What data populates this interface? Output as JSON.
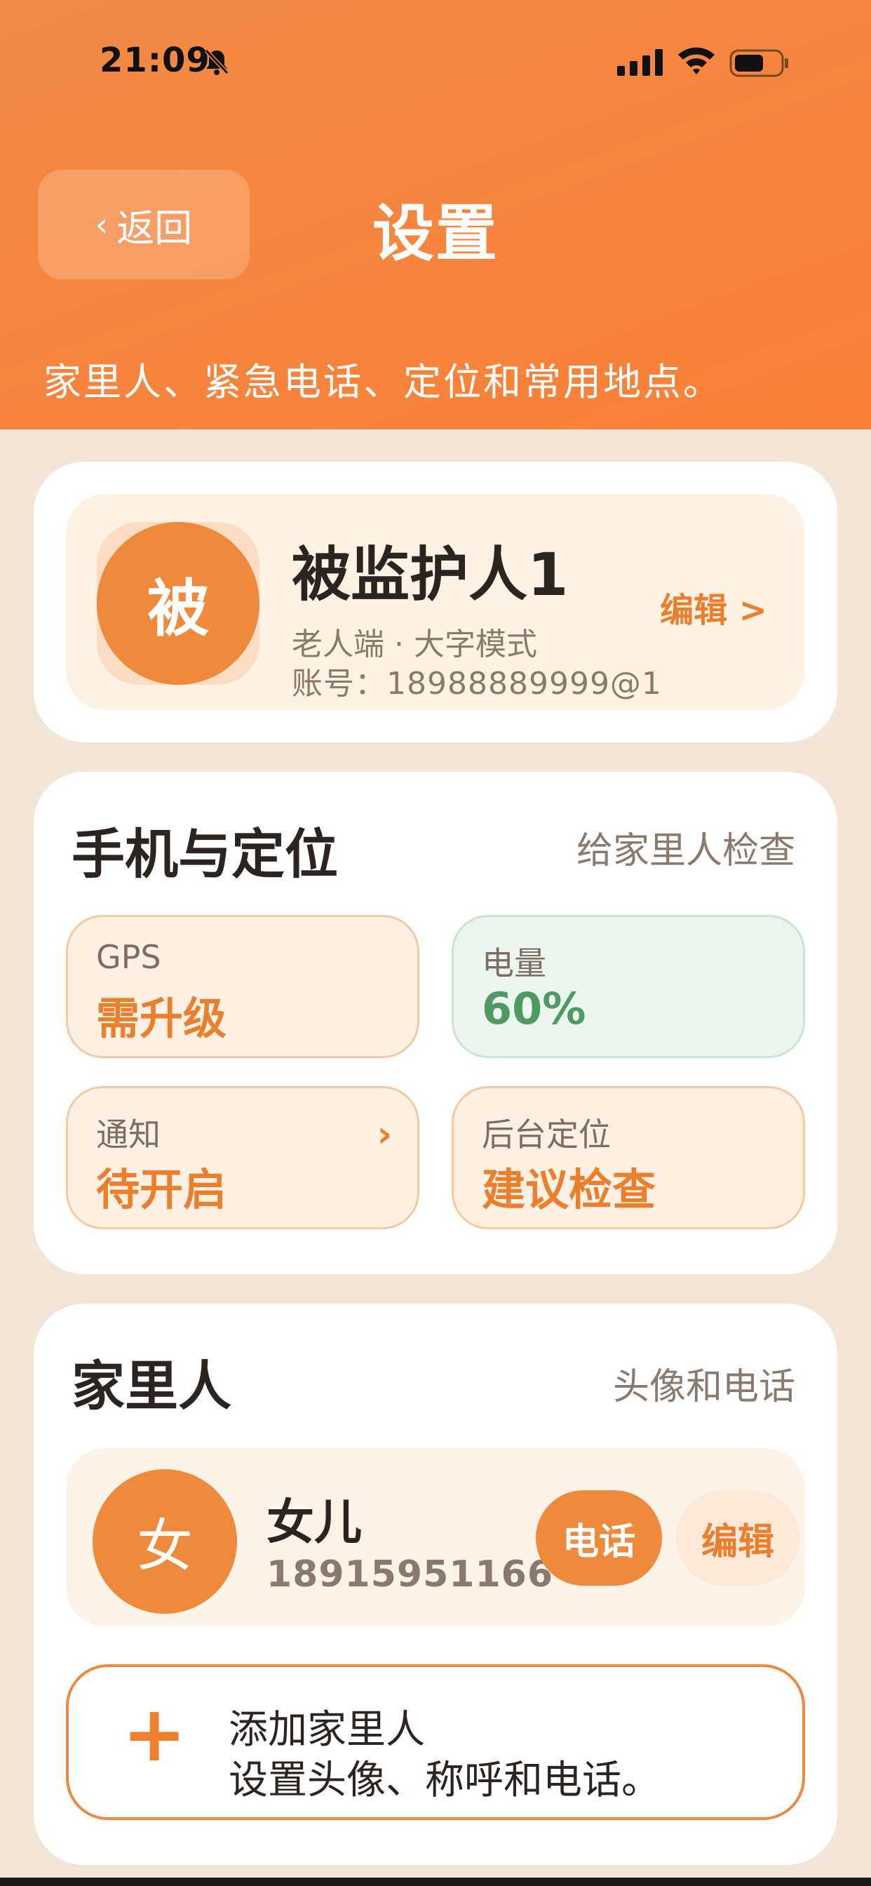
{
  "status_bar": {
    "time": "21:09"
  },
  "header": {
    "back_label": "返回",
    "title": "设置",
    "subtitle": "家里人、紧急电话、定位和常用地点。"
  },
  "profile": {
    "avatar_char": "被",
    "name": "被监护人1",
    "mode": "老人端 · 大字模式",
    "account": "账号：18988889999@1",
    "edit_label": "编辑 >"
  },
  "phone_section": {
    "title": "手机与定位",
    "hint": "给家里人检查",
    "tiles": [
      {
        "label": "GPS",
        "value": "需升级",
        "tone": "orange"
      },
      {
        "label": "电量",
        "value": "60%",
        "tone": "green"
      },
      {
        "label": "通知",
        "value": "待开启",
        "tone": "orange",
        "chevron": "›"
      },
      {
        "label": "后台定位",
        "value": "建议检查",
        "tone": "orange"
      }
    ]
  },
  "family_section": {
    "title": "家里人",
    "hint": "头像和电话",
    "members": [
      {
        "avatar_char": "女",
        "name": "女儿",
        "phone": "18915951166",
        "call_label": "电话",
        "edit_label": "编辑"
      }
    ],
    "add": {
      "plus": "+",
      "line1": "添加家里人",
      "line2": "设置头像、称呼和电话。"
    }
  },
  "colors": {
    "header_orange": "#f8833b",
    "accent_orange": "#ec7f2d",
    "background": "#f3e6d8",
    "ok_green": "#4e9a63"
  }
}
